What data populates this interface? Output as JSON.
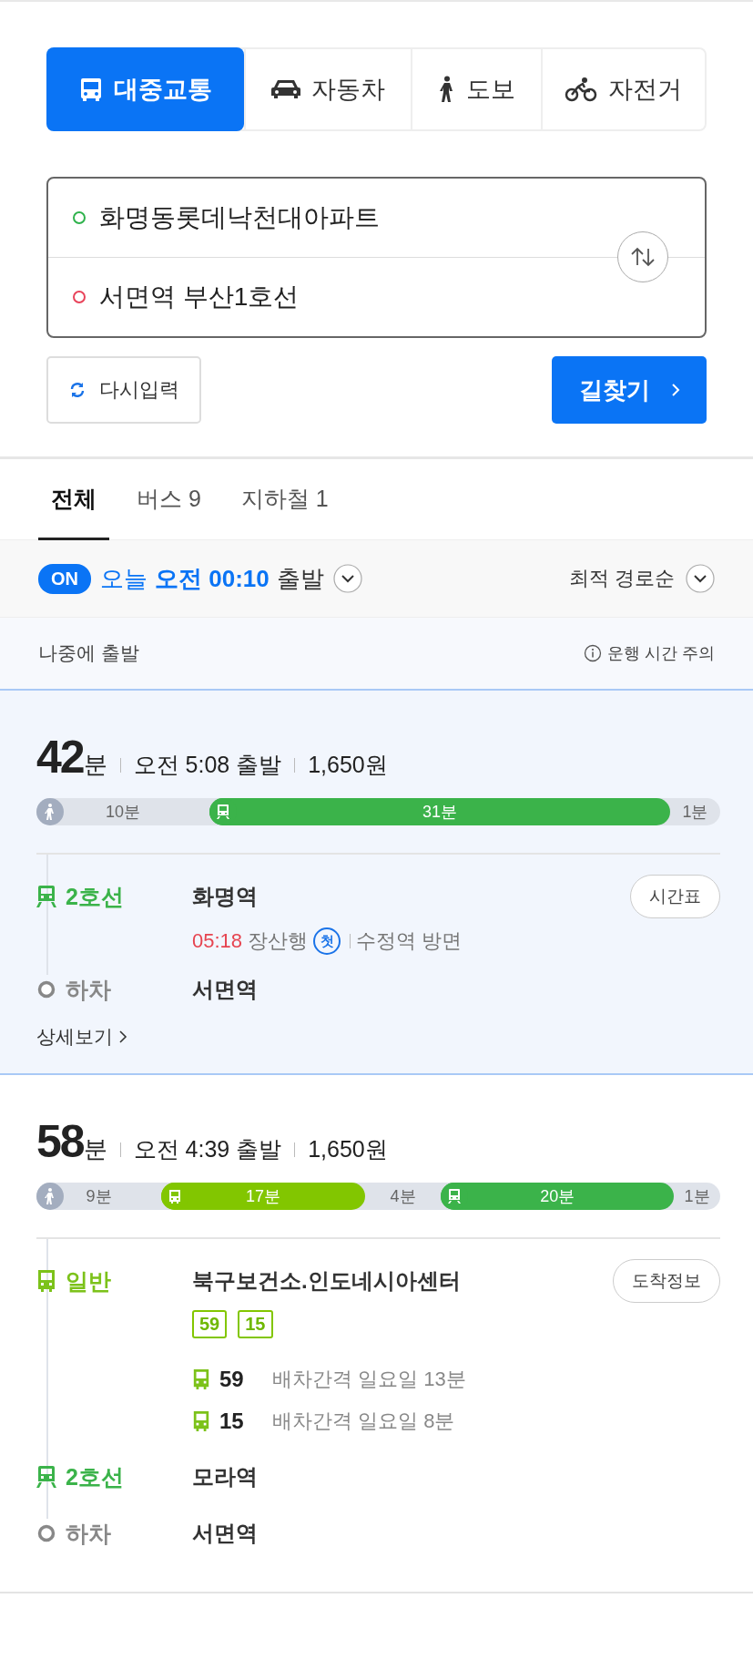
{
  "modes": [
    {
      "kind": "transit",
      "label": "대중교통",
      "selected": true
    },
    {
      "kind": "car",
      "label": "자동차",
      "selected": false
    },
    {
      "kind": "walk",
      "label": "도보",
      "selected": false
    },
    {
      "kind": "bike",
      "label": "자전거",
      "selected": false
    }
  ],
  "waypoints": [
    {
      "value": "화명동롯데낙천대아파트",
      "color": "#2fb24c"
    },
    {
      "value": "서면역 부산1호선",
      "color": "#e8435a"
    }
  ],
  "reset_button": "다시입력",
  "search_button": "길찾기",
  "result_tabs": [
    {
      "label": "전체",
      "selected": true
    },
    {
      "label": "버스 9",
      "selected": false
    },
    {
      "label": "지하철 1",
      "selected": false
    }
  ],
  "departure": {
    "on": true,
    "toggle": "ON",
    "day": "오늘",
    "time": "오전 00:10",
    "suffix": "출발"
  },
  "sort": "최적 경로순",
  "later": "나중에 출발",
  "notice": "운행 시간 주의",
  "routes": [
    {
      "selected": true,
      "minutes": "42",
      "unit": "분",
      "depart": "오전 5:08 출발",
      "fare": "1,650원",
      "segments": [
        {
          "kind": "walk",
          "label": "10분"
        },
        {
          "kind": "subway",
          "label": "31분",
          "color": "#3bb34a"
        },
        {
          "kind": "walk",
          "label": "1분"
        }
      ],
      "steps": [
        {
          "kind": "subway",
          "label": "2호선",
          "color": "#3bb34a",
          "station": "화명역",
          "button": "시간표",
          "arrival": {
            "time": "05:18",
            "dest": "장산행",
            "badge": "첫",
            "direction": "수정역 방면"
          }
        },
        {
          "kind": "alight",
          "label": "하차",
          "station": "서면역"
        }
      ],
      "more": "상세보기"
    },
    {
      "selected": false,
      "minutes": "58",
      "unit": "분",
      "depart": "오전 4:39 출발",
      "fare": "1,650원",
      "segments": [
        {
          "kind": "walk",
          "label": "9분"
        },
        {
          "kind": "bus",
          "label": "17분",
          "color": "#82c600"
        },
        {
          "kind": "walk",
          "label": "4분"
        },
        {
          "kind": "subway",
          "label": "20분",
          "color": "#3bb34a"
        },
        {
          "kind": "walk",
          "label": "1분"
        }
      ],
      "steps": [
        {
          "kind": "bus",
          "label": "일반",
          "color": "#7cc21a",
          "station": "북구보건소.인도네시아센터",
          "button": "도착정보",
          "badges": [
            "59",
            "15"
          ],
          "buses": [
            {
              "number": "59",
              "info": "배차간격 일요일 13분"
            },
            {
              "number": "15",
              "info": "배차간격 일요일 8분"
            }
          ]
        },
        {
          "kind": "subway",
          "label": "2호선",
          "color": "#3bb34a",
          "station": "모라역"
        },
        {
          "kind": "alight",
          "label": "하차",
          "station": "서면역"
        }
      ]
    }
  ]
}
